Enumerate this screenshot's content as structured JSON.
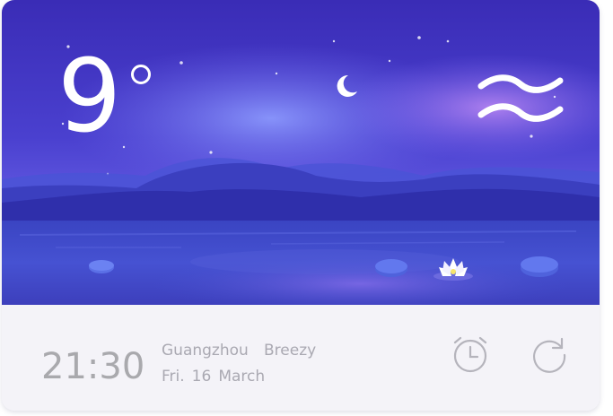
{
  "weather": {
    "temperature": "9",
    "condition": "Breezy",
    "condition_icon": "wind-icon",
    "night_icon": "crescent-moon-icon"
  },
  "footer": {
    "time": "21:30",
    "city": "Guangzhou",
    "day": "Fri.",
    "date": "16",
    "month": "March"
  },
  "actions": {
    "alarm_icon": "alarm-clock-icon",
    "refresh_icon": "refresh-icon"
  },
  "colors": {
    "sky_top": "#3b2fb8",
    "sky_glow": "#7b6cf0",
    "mountains": "#3d3fc0",
    "lake": "#3e48c6",
    "footer_bg": "#f4f3f8",
    "footer_text": "#aaa9b2"
  }
}
